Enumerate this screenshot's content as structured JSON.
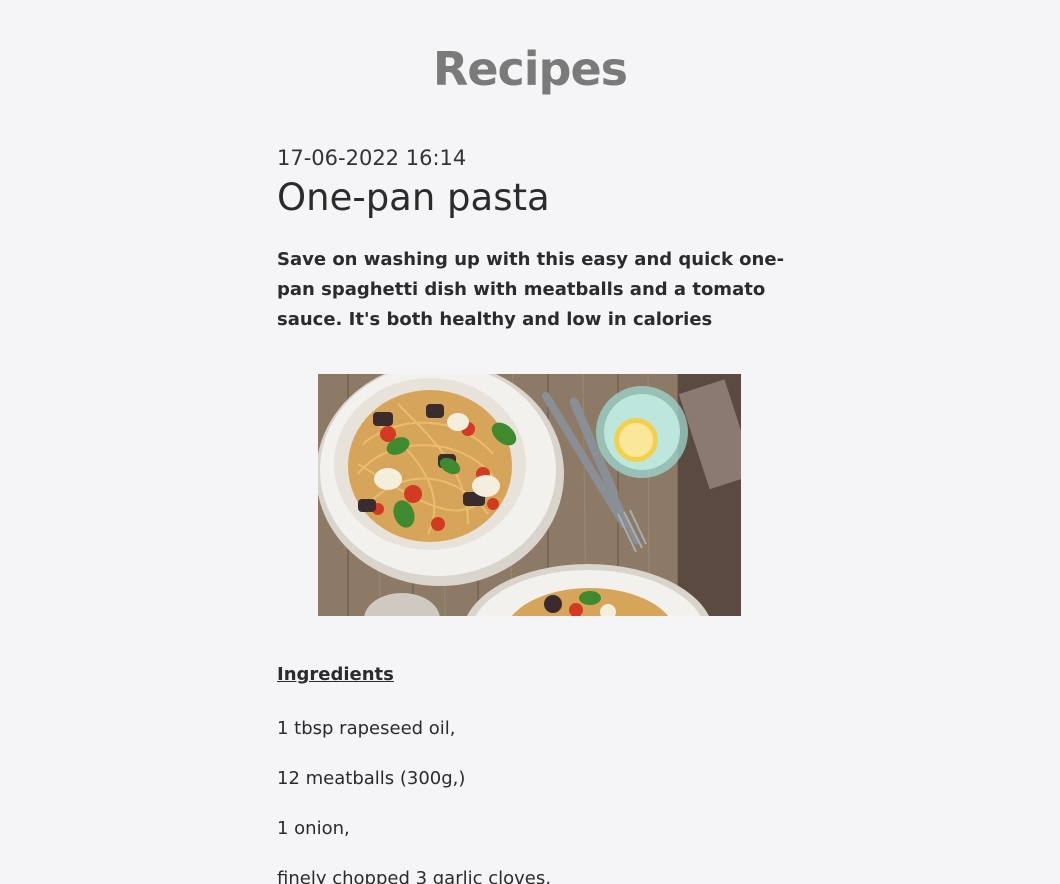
{
  "site": {
    "title": "Recipes"
  },
  "post": {
    "date": "17-06-2022 16:14",
    "title": "One-pan pasta",
    "summary": "Save on washing up with this easy and quick one-pan spaghetti dish with meatballs and a tomato sauce. It's both healthy and low in calories",
    "image_subject": "spaghetti-with-meatballs-photo"
  },
  "ingredients": {
    "heading": "Ingredients",
    "items": [
      "1 tbsp rapeseed oil,",
      "12 meatballs (300g,)",
      "1 onion,",
      "finely chopped 3 garlic cloves,"
    ]
  }
}
